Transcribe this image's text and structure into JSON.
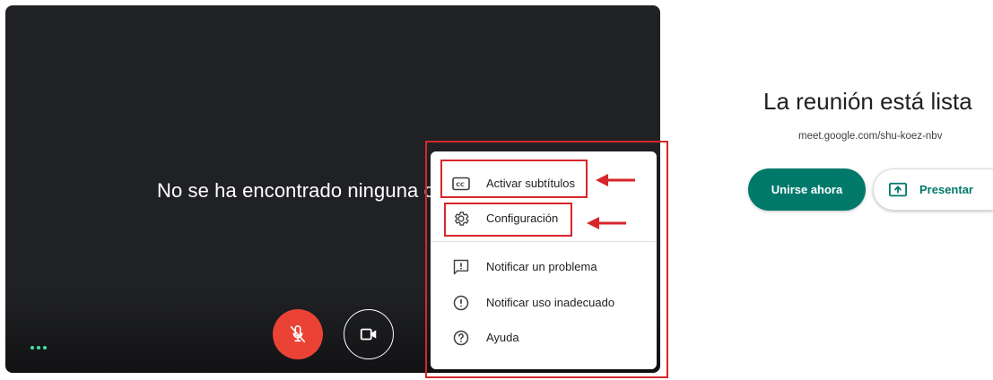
{
  "preview": {
    "camera_message": "No se ha encontrado ninguna cámara",
    "mic_icon": "mic-off-icon",
    "camera_icon": "videocam-icon",
    "more_icon": "more-horiz-icon"
  },
  "menu": {
    "items": [
      {
        "label": "Activar subtítulos",
        "icon": "closed-caption-icon",
        "highlighted": true
      },
      {
        "label": "Configuración",
        "icon": "settings-gear-icon",
        "highlighted": true
      },
      {
        "label": "Notificar un problema",
        "icon": "feedback-icon",
        "highlighted": false
      },
      {
        "label": "Notificar uso inadecuado",
        "icon": "report-icon",
        "highlighted": false
      },
      {
        "label": "Ayuda",
        "icon": "help-icon",
        "highlighted": false
      }
    ]
  },
  "meeting": {
    "title": "La reunión está lista",
    "link": "meet.google.com/shu-koez-nbv",
    "join_label": "Unirse ahora",
    "present_label": "Presentar",
    "present_icon": "present-screen-icon"
  },
  "colors": {
    "accent": "#00796b",
    "mic_off": "#ea4335",
    "annotation": "#d6262a",
    "preview_bg": "#202124"
  }
}
